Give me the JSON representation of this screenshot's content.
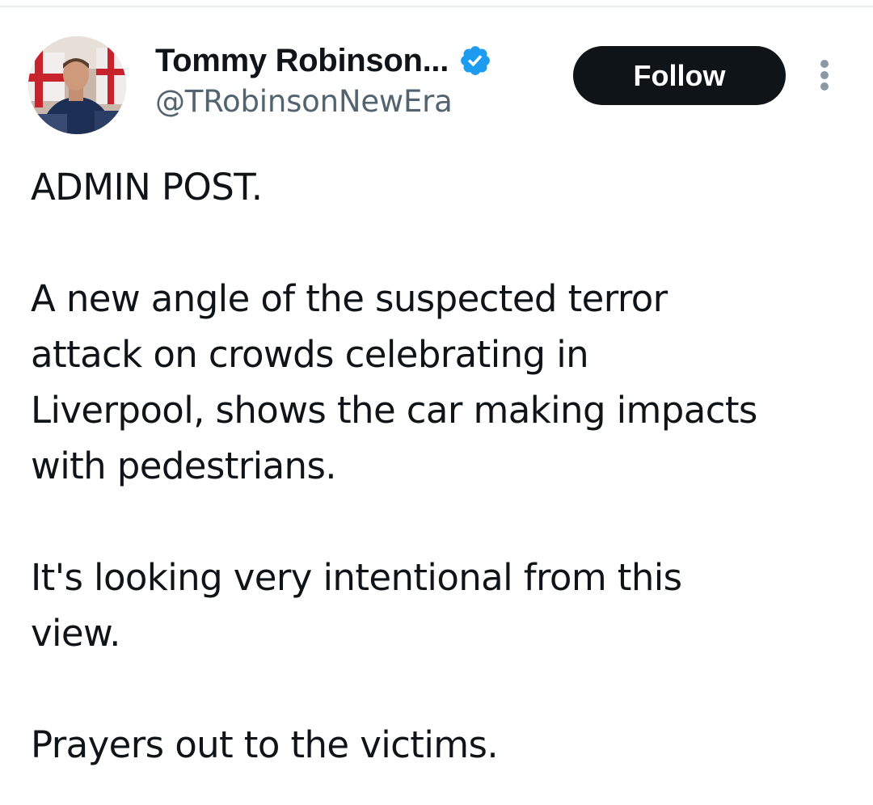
{
  "author": {
    "display_name": "Tommy Robinson...",
    "handle": "@TRobinsonNewEra",
    "verified": true
  },
  "actions": {
    "follow_label": "Follow",
    "more_icon": "more-vertical-icon"
  },
  "tweet": {
    "paragraphs": [
      "ADMIN POST.",
      "A new angle of the suspected terror\nattack on crowds celebrating in\nLiverpool, shows the car making impacts\nwith pedestrians.",
      "It's looking very intentional from this\nview.",
      "Prayers out to the victims."
    ]
  },
  "colors": {
    "verified_badge": "#1d9bf0",
    "follow_button_bg": "#0f1419",
    "handle_text": "#536471"
  }
}
